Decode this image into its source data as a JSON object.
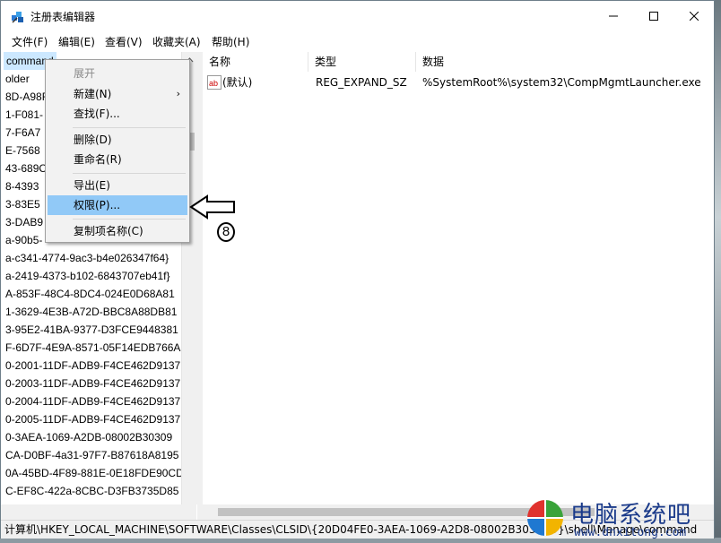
{
  "window": {
    "title": "注册表编辑器"
  },
  "menubar": [
    "文件(F)",
    "编辑(E)",
    "查看(V)",
    "收藏夹(A)",
    "帮助(H)"
  ],
  "tree": {
    "selected": "command",
    "rows": [
      "older",
      "8D-A98F",
      "1-F081-",
      "7-F6A7",
      "E-7568",
      "43-689C",
      "8-4393",
      "3-83E5",
      "3-DAB9",
      "a-90b5-",
      "a-c341-4774-9ac3-b4e026347f64}",
      "a-2419-4373-b102-6843707eb41f}",
      "A-853F-48C4-8DC4-024E0D68A81",
      "1-3629-4E3B-A72D-BBC8A88DB81",
      "3-95E2-41BA-9377-D3FCE9448381",
      "F-6D7F-4E9A-8571-05F14EDB766A",
      "0-2001-11DF-ADB9-F4CE462D9137",
      "0-2003-11DF-ADB9-F4CE462D9137",
      "0-2004-11DF-ADB9-F4CE462D9137",
      "0-2005-11DF-ADB9-F4CE462D9137",
      "0-3AEA-1069-A2DB-08002B30309",
      "CA-D0BF-4a31-97F7-B87618A8195",
      "0A-45BD-4F89-881E-0E18FDE90CD",
      "C-EF8C-422a-8CBC-D3FB3735D85"
    ]
  },
  "columns": {
    "name": "名称",
    "type": "类型",
    "data": "数据"
  },
  "values": [
    {
      "name": "(默认)",
      "type": "REG_EXPAND_SZ",
      "data": "%SystemRoot%\\system32\\CompMgmtLauncher.exe"
    }
  ],
  "context_menu": {
    "items": [
      {
        "label": "展开",
        "disabled": true
      },
      {
        "label": "新建(N)",
        "submenu": true
      },
      {
        "label": "查找(F)..."
      },
      {
        "label": "删除(D)"
      },
      {
        "label": "重命名(R)"
      },
      {
        "label": "导出(E)"
      },
      {
        "label": "权限(P)...",
        "highlighted": true
      },
      {
        "label": "复制项名称(C)"
      }
    ]
  },
  "annotation": {
    "step": "8"
  },
  "statusbar": {
    "path": "计算机\\HKEY_LOCAL_MACHINE\\SOFTWARE\\Classes\\CLSID\\{20D04FE0-3AEA-1069-A2D8-08002B30309D}\\shell\\Manage\\command"
  },
  "watermark": {
    "name": "电脑系统吧",
    "url": "www.dnxitong.com"
  },
  "icons": [
    "regedit-icon",
    "minimize-icon",
    "maximize-icon",
    "close-icon",
    "string-value-icon",
    "chevron-right-icon",
    "chevron-up-icon",
    "windows-logo-icon"
  ]
}
